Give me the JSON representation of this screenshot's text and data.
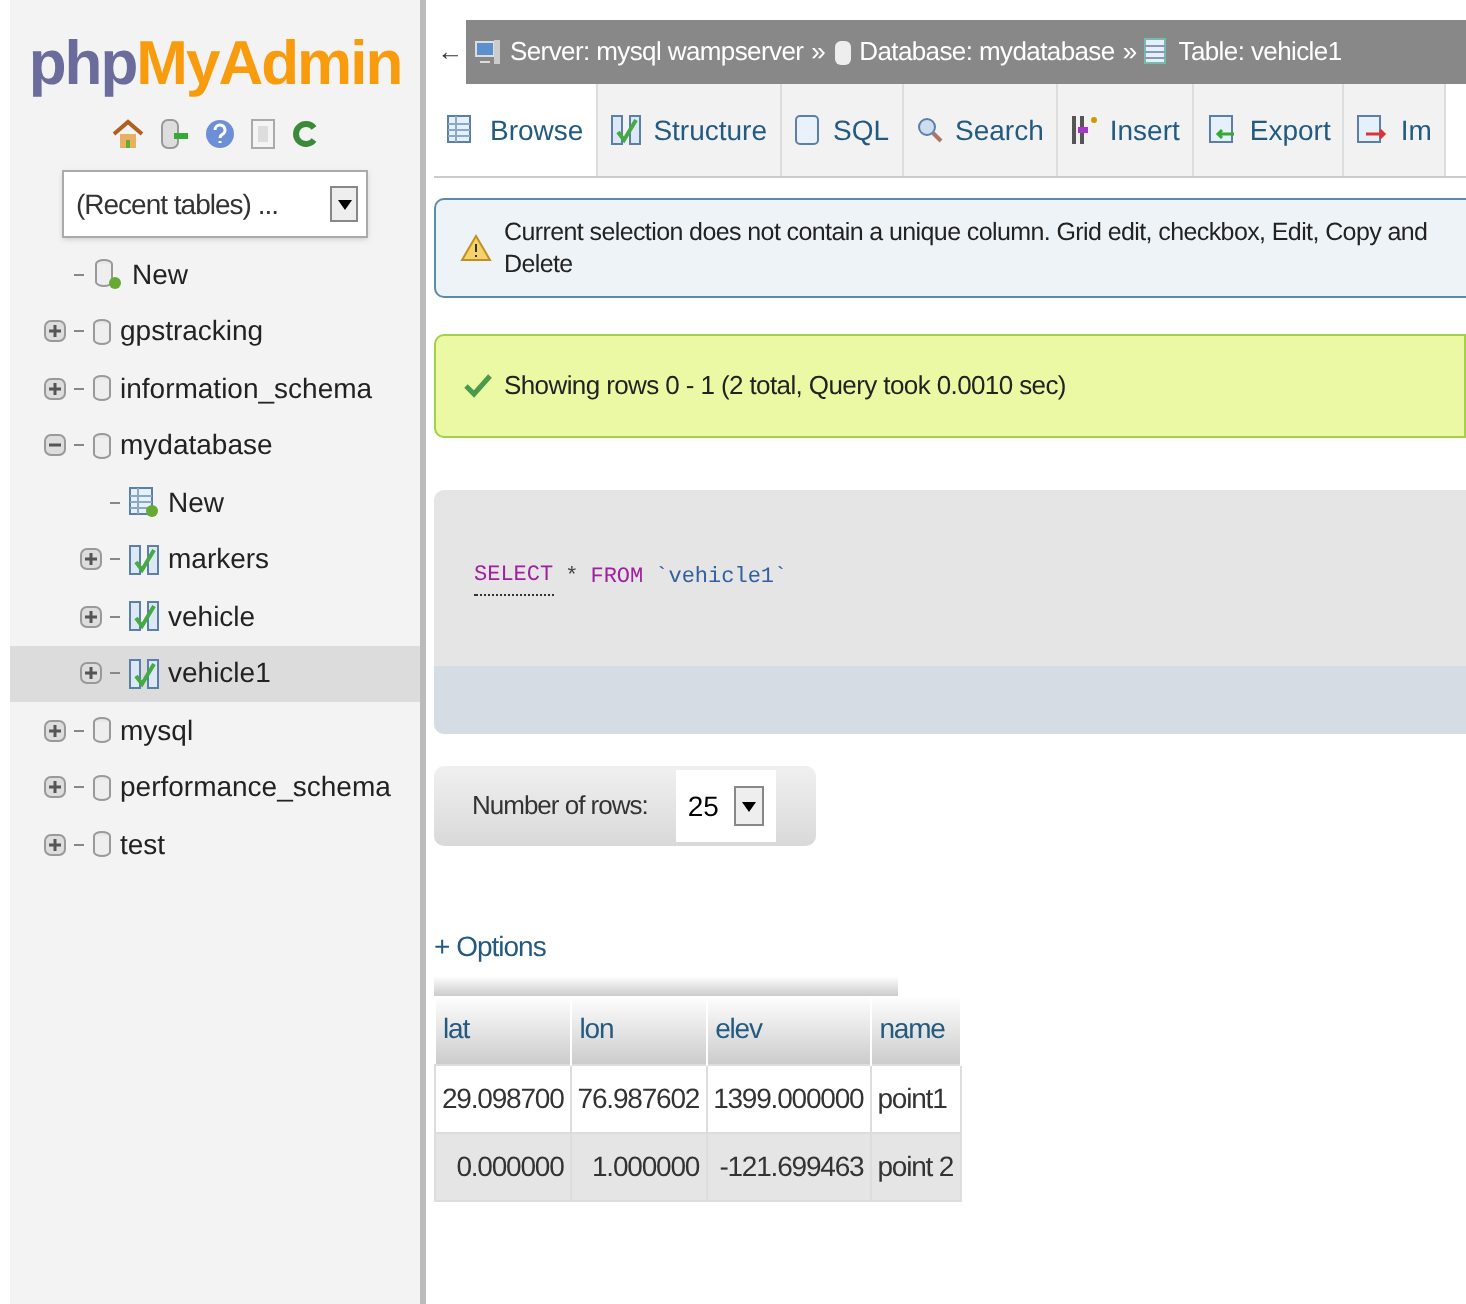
{
  "sidebar": {
    "logo": {
      "part1": "php",
      "part2": "MyAdmin"
    },
    "recent_tables": {
      "value": "(Recent tables) ..."
    },
    "tree": [
      {
        "label": "New",
        "kind": "new",
        "selected": false
      },
      {
        "label": "gpstracking",
        "kind": "database",
        "expanded": false,
        "selected": false
      },
      {
        "label": "information_schema",
        "kind": "database",
        "expanded": false,
        "selected": false
      },
      {
        "label": "mydatabase",
        "kind": "database",
        "expanded": true,
        "selected": false,
        "children": [
          {
            "label": "New",
            "kind": "new_table",
            "selected": false
          },
          {
            "label": "markers",
            "kind": "table",
            "selected": false
          },
          {
            "label": "vehicle",
            "kind": "table",
            "selected": false
          },
          {
            "label": "vehicle1",
            "kind": "table",
            "selected": true
          }
        ]
      },
      {
        "label": "mysql",
        "kind": "database",
        "expanded": false,
        "selected": false
      },
      {
        "label": "performance_schema",
        "kind": "database",
        "expanded": false,
        "selected": false
      },
      {
        "label": "test",
        "kind": "database",
        "expanded": false,
        "selected": false
      }
    ]
  },
  "breadcrumb": {
    "back": "←",
    "items": [
      {
        "kind": "server",
        "label": "Server: mysql wampserver"
      },
      {
        "kind": "database",
        "label": "Database: mydatabase"
      },
      {
        "kind": "table",
        "label": "Table: vehicle1"
      }
    ],
    "separator": "»"
  },
  "tabs": [
    {
      "label": "Browse",
      "kind": "browse",
      "selected": true
    },
    {
      "label": "Structure",
      "kind": "structure",
      "selected": false
    },
    {
      "label": "SQL",
      "kind": "sql",
      "selected": false
    },
    {
      "label": "Search",
      "kind": "search",
      "selected": false
    },
    {
      "label": "Insert",
      "kind": "insert",
      "selected": false
    },
    {
      "label": "Export",
      "kind": "export",
      "selected": false
    },
    {
      "label": "Im",
      "kind": "import",
      "selected": false
    }
  ],
  "warning": "Current selection does not contain a unique column. Grid edit, checkbox, Edit, Copy and Delete",
  "success": "Showing rows 0 - 1 (2 total, Query took 0.0010 sec)",
  "sql_query": [
    {
      "text": "SELECT",
      "kind": "keyword_link"
    },
    {
      "text": "*",
      "kind": "operator"
    },
    {
      "text": "FROM",
      "kind": "keyword"
    },
    {
      "text": "`vehicle1`",
      "kind": "identifier"
    }
  ],
  "number_of_rows": {
    "label": "Number of rows:",
    "value": "25"
  },
  "options_link": "+ Options",
  "table": {
    "columns": [
      "lat",
      "lon",
      "elev",
      "name"
    ],
    "rows": [
      [
        "29.098700",
        "76.987602",
        "1399.000000",
        "point1"
      ],
      [
        "0.000000",
        "1.000000",
        "-121.699463",
        "point 2"
      ]
    ]
  }
}
